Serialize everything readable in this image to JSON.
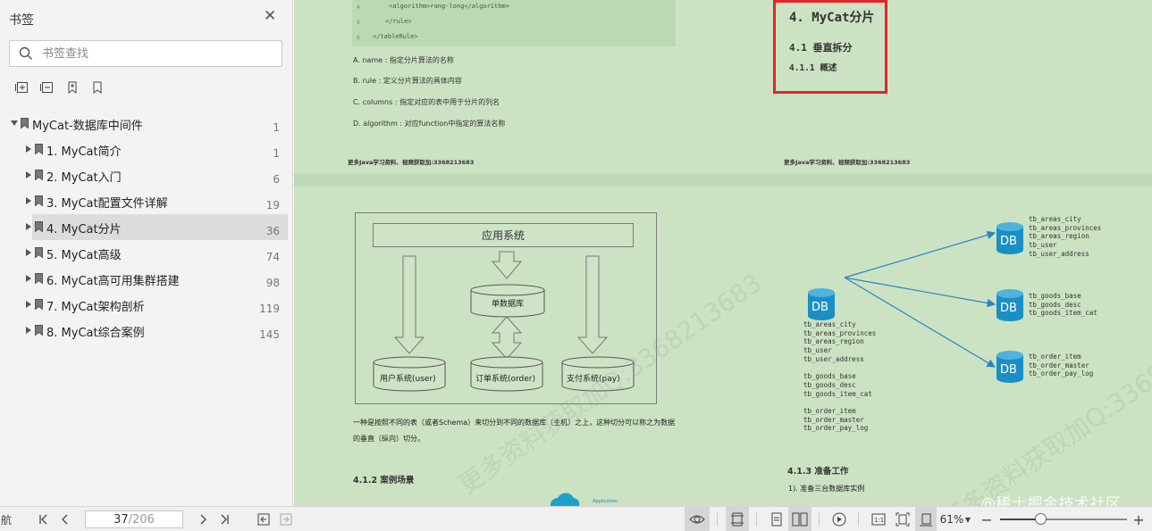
{
  "sidebar": {
    "title": "书签",
    "search_placeholder": "书签查找",
    "tree": [
      {
        "label": "MyCat-数据库中间件",
        "page": "1",
        "level": 0,
        "expanded": true
      },
      {
        "label": "1. MyCat简介",
        "page": "1",
        "level": 1
      },
      {
        "label": "2. MyCat入门",
        "page": "6",
        "level": 1
      },
      {
        "label": "3. MyCat配置文件详解",
        "page": "19",
        "level": 1
      },
      {
        "label": "4. MyCat分片",
        "page": "36",
        "level": 1,
        "selected": true
      },
      {
        "label": "5. MyCat高级",
        "page": "74",
        "level": 1
      },
      {
        "label": "6. MyCat高可用集群搭建",
        "page": "98",
        "level": 1
      },
      {
        "label": "7. MyCat架构剖析",
        "page": "119",
        "level": 1
      },
      {
        "label": "8. MyCat综合案例",
        "page": "145",
        "level": 1
      }
    ]
  },
  "doc": {
    "page1_left": {
      "code_lines": [
        {
          "num": "4",
          "text": "<algorithm>rang-long</algorithm>"
        },
        {
          "num": "5",
          "text": "</rule>"
        },
        {
          "num": "6",
          "text": "</tableRule>"
        }
      ],
      "desc": [
        "A. name : 指定分片算法的名称",
        "B. rule : 定义分片算法的具体内容",
        "C. columns : 指定对应的表中用于分片的列名",
        "D. algorithm : 对应function中指定的算法名称"
      ],
      "footer": "更多Java学习资料、视频获取加:3368213683"
    },
    "page1_right": {
      "h1": "4. MyCat分片",
      "h2": "4.1 垂直拆分",
      "h3": "4.1.1 概述",
      "footer": "更多Java学习资料、视频获取加:3368213683"
    },
    "page2_left": {
      "app_label": "应用系统",
      "single_db": "单数据库",
      "user_sys": "用户系统(user)",
      "order_sys": "订单系统(order)",
      "pay_sys": "支付系统(pay)",
      "para_line1": "一种是按照不同的表（或者Schema）来切分到不同的数据库（主机）之上，这种切分可以称之为数据",
      "para_line2": "的垂直（纵向）切分。",
      "sec": "4.1.2 案例场景",
      "cloud_label": "Application"
    },
    "page2_right": {
      "db_label": "DB",
      "left_tables": "tb_areas_city\ntb_areas_provinces\ntb_areas_region\ntb_user\ntb_user_address\n\ntb_goods_base\ntb_goods_desc\ntb_goods_item_cat\n\ntb_order_item\ntb_order_master\ntb_order_pay_log",
      "db1_tables": "tb_areas_city\ntb_areas_provinces\ntb_areas_region\ntb_user\ntb_user_address",
      "db2_tables": "tb_goods_base\ntb_goods_desc\ntb_goods_item_cat",
      "db3_tables": "tb_order_item\ntb_order_master\ntb_order_pay_log",
      "sec": "4.1.3 准备工作",
      "step": "1). 准备三台数据库实例"
    },
    "watermark": "更多资料获取加Q:3368213683",
    "brand": "@稀土掘金技术社区"
  },
  "statusbar": {
    "nav_label": "航",
    "current_page": "37",
    "total_pages": "/206",
    "zoom": "61%",
    "zoom_level": 0.32
  },
  "colors": {
    "doc_bg": "#cbe3c2",
    "highlight": "#e0262b",
    "db_blue": "#1a8fc4",
    "arrow_blue": "#2b84c6"
  }
}
